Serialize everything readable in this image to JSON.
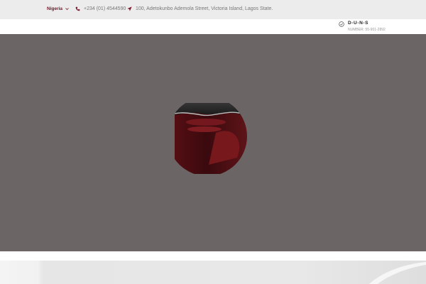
{
  "topbar": {
    "country": "Nigeria",
    "phone": "+234 (01) 4544590",
    "address": "100, Adetokunbo Ademola Street, Victoria Island, Lagos State."
  },
  "duns": {
    "title": "D-U-N-S",
    "number": "NUMBER: 55-901-2892"
  },
  "icons": {
    "chevron": "chevron-down-icon",
    "phone": "phone-icon",
    "location": "location-arrow-icon",
    "duns": "check-circle-icon"
  },
  "colors": {
    "topbar_bg": "#ececec",
    "accent": "#7a1326",
    "hero_bg": "#6b6565"
  }
}
